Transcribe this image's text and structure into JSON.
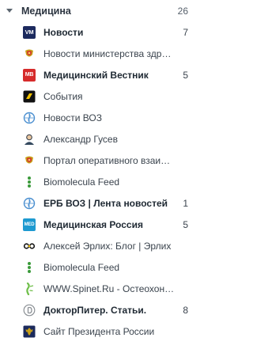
{
  "group": {
    "title": "Медицина",
    "count": "26"
  },
  "icons": {
    "vm_text": "VM",
    "mv_text": "MB",
    "med_text": "MED"
  },
  "colors": {
    "vm": "#1c2a5e",
    "mv": "#d62b2b",
    "med": "#1e9ad0",
    "who": "#4a8fd0",
    "green": "#3a9a3a",
    "yellow": "#f2c200"
  },
  "feeds": [
    {
      "label": "Новости",
      "count": "7",
      "unread": true,
      "icon": "vm-logo-icon"
    },
    {
      "label": "Новости министерства здравоохранения",
      "count": "",
      "unread": false,
      "icon": "coat-of-arms-icon"
    },
    {
      "label": "Медицинский Вестник",
      "count": "5",
      "unread": true,
      "icon": "mv-logo-icon"
    },
    {
      "label": "События",
      "count": "",
      "unread": false,
      "icon": "events-logo-icon"
    },
    {
      "label": "Новости ВОЗ",
      "count": "",
      "unread": false,
      "icon": "who-logo-icon"
    },
    {
      "label": "Александр Гусев",
      "count": "",
      "unread": false,
      "icon": "person-avatar-icon"
    },
    {
      "label": "Портал оперативного взаимодействия",
      "count": "",
      "unread": false,
      "icon": "coat-of-arms-icon"
    },
    {
      "label": "Biomolecula Feed",
      "count": "",
      "unread": false,
      "icon": "biomolecula-icon"
    },
    {
      "label": "ЕРБ ВОЗ | Лента новостей",
      "count": "1",
      "unread": true,
      "icon": "who-logo-icon"
    },
    {
      "label": "Медицинская Россия",
      "count": "5",
      "unread": true,
      "icon": "med-logo-icon"
    },
    {
      "label": "Алексей Эрлих: Блог | Эрлих",
      "count": "",
      "unread": false,
      "icon": "erlikh-logo-icon"
    },
    {
      "label": "Biomolecula Feed",
      "count": "",
      "unread": false,
      "icon": "biomolecula-icon"
    },
    {
      "label": "WWW.Spinet.Ru - Остеохондроз",
      "count": "",
      "unread": false,
      "icon": "spinet-logo-icon"
    },
    {
      "label": "ДокторПитер. Статьи.",
      "count": "8",
      "unread": true,
      "icon": "doctorpiter-logo-icon"
    },
    {
      "label": "Сайт Президента России",
      "count": "",
      "unread": false,
      "icon": "kremlin-emblem-icon"
    }
  ]
}
